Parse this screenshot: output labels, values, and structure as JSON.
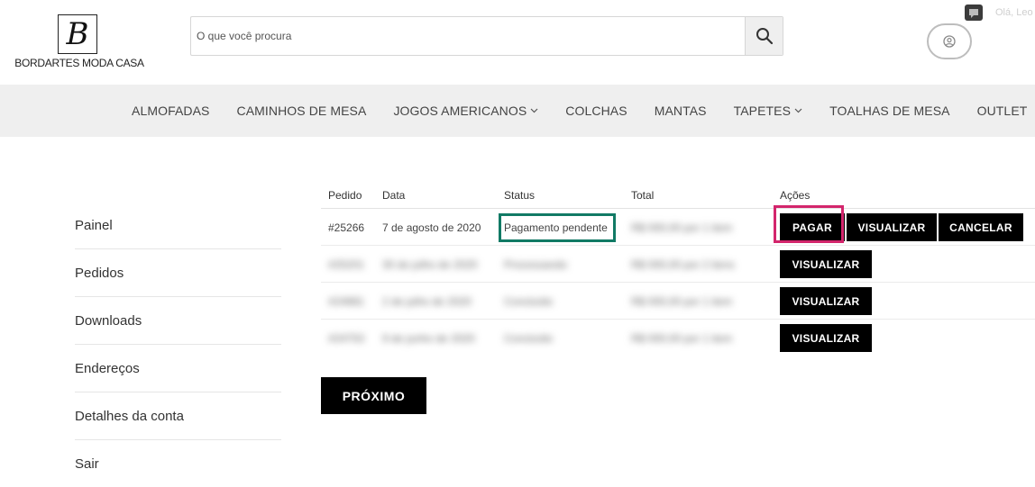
{
  "brand": {
    "logo_letter": "B",
    "name": "BORDARTES MODA CASA"
  },
  "search": {
    "placeholder": "O que você procura"
  },
  "header": {
    "greeting": "Olá, Leo"
  },
  "nav": {
    "items": [
      {
        "label": "ALMOFADAS"
      },
      {
        "label": "CAMINHOS DE MESA"
      },
      {
        "label": "JOGOS AMERICANOS"
      },
      {
        "label": "COLCHAS"
      },
      {
        "label": "MANTAS"
      },
      {
        "label": "TAPETES"
      },
      {
        "label": "TOALHAS DE MESA"
      },
      {
        "label": "OUTLET"
      }
    ]
  },
  "sidebar": {
    "items": [
      {
        "label": "Painel"
      },
      {
        "label": "Pedidos"
      },
      {
        "label": "Downloads"
      },
      {
        "label": "Endereços"
      },
      {
        "label": "Detalhes da conta"
      },
      {
        "label": "Sair"
      }
    ]
  },
  "orders": {
    "headers": {
      "order": "Pedido",
      "date": "Data",
      "status": "Status",
      "total": "Total",
      "actions": "Ações"
    },
    "rows": [
      {
        "order": "#25266",
        "date": "7 de agosto de 2020",
        "status": "Pagamento pendente",
        "total": "R$ 000,00 por 1 item"
      },
      {
        "order": "#25201",
        "date": "30 de julho de 2020",
        "status": "Processando",
        "total": "R$ 000,00 por 2 itens"
      },
      {
        "order": "#24981",
        "date": "2 de julho de 2020",
        "status": "Concluído",
        "total": "R$ 000,00 por 1 item"
      },
      {
        "order": "#24753",
        "date": "9 de junho de 2020",
        "status": "Concluído",
        "total": "R$ 000,00 por 1 item"
      }
    ],
    "actions": {
      "pay": "PAGAR",
      "view": "VISUALIZAR",
      "cancel": "CANCELAR"
    },
    "next": "PRÓXIMO"
  },
  "colors": {
    "status_highlight": "#117a65",
    "pay_highlight": "#d3256c",
    "button_bg": "#000000",
    "nav_bg": "#efefef"
  }
}
